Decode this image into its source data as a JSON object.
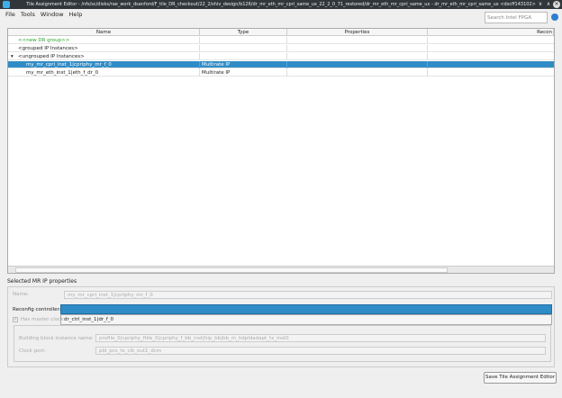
{
  "window": {
    "title": "Tile Assignment Editor - /nfs/sc/disks/rae_work_dsanford/F_tile_DR_checkout/22_2/shiv_design/b126/dr_mr_eth_mr_cpri_same_ux_22_2_0_71_restored/dr_mr_eth_mr_cpri_same_ux - dr_mr_eth_mr_cpri_same_ux <dscff143102>",
    "min": "∨",
    "max": "∧",
    "close": "✕"
  },
  "menu": [
    "File",
    "Tools",
    "Window",
    "Help"
  ],
  "search": {
    "placeholder": "Search Intel FPGA"
  },
  "table": {
    "headers": [
      "Name",
      "Type",
      "Properties",
      "Recon"
    ],
    "rows": [
      {
        "name": "<<new DR group>>",
        "type": ""
      },
      {
        "name": "<grouped IP Instances>",
        "type": ""
      },
      {
        "name": "<ungrouped IP Instances>",
        "type": "",
        "expander": "▾"
      },
      {
        "name": "my_mr_cpri_inst_1|cpriphy_mr_f_0",
        "type": "Multirate IP"
      },
      {
        "name": "my_mr_eth_inst_1|eth_f_dr_0",
        "type": "Multirate IP"
      }
    ]
  },
  "props": {
    "title": "Selected MR IP properties",
    "name_label": "Name:",
    "name_value": "my_mr_cpri_inst_1|cpriphy_mr_f_0",
    "reconfig_label": "Reconfig controller:",
    "reconfig_option": "dr_ctrl_inst_1|dr_f_0",
    "master_clock_label": "Has master clock",
    "bb_label": "Building block instance name:",
    "bb_value": "profile_0|cpriphy_ftile_0|cpriphy_f_bb_inst|hip_bb|bb_m_hdpldadapt_tx_inst0",
    "clock_label": "Clock port:",
    "clock_value": "pld_pcs_tx_clk_out1_dcm"
  },
  "save_button": "Save Tile Assignment Editor",
  "colors": {
    "selection": "#308cc6",
    "new_group": "#2ea02e"
  }
}
